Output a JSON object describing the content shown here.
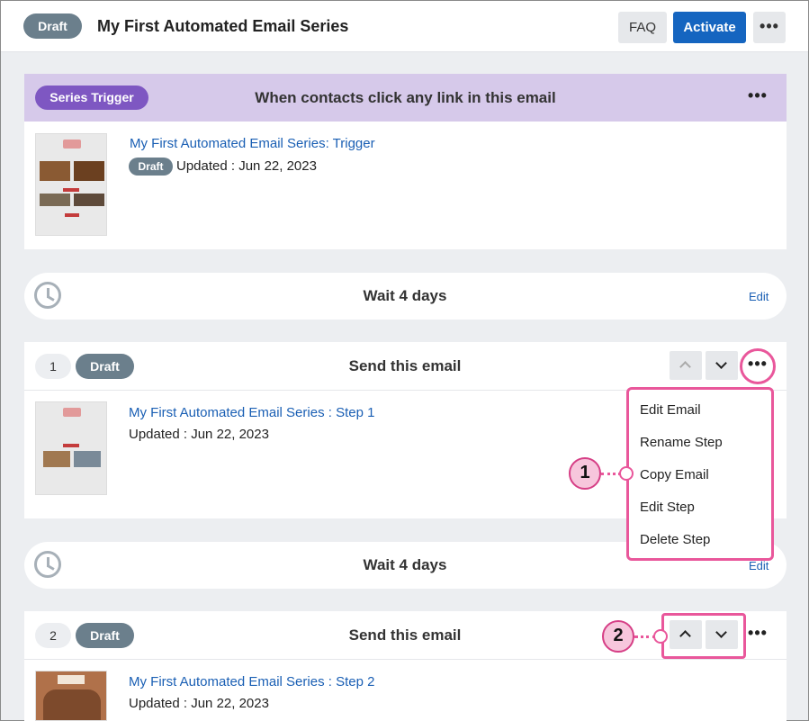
{
  "header": {
    "status_badge": "Draft",
    "title": "My First Automated Email Series",
    "faq_label": "FAQ",
    "activate_label": "Activate",
    "more_label": "•••"
  },
  "trigger": {
    "badge": "Series Trigger",
    "heading": "When contacts click any link in this email",
    "more_label": "•••",
    "email_title": "My First Automated Email Series: Trigger",
    "status_badge": "Draft",
    "updated": "Updated : Jun 22, 2023"
  },
  "waits": [
    {
      "label": "Wait 4 days",
      "edit_label": "Edit"
    },
    {
      "label": "Wait 4 days",
      "edit_label": "Edit"
    }
  ],
  "steps": [
    {
      "number": "1",
      "status_badge": "Draft",
      "heading": "Send this email",
      "more_label": "•••",
      "email_title": "My First Automated Email Series : Step 1",
      "updated": "Updated : Jun 22, 2023"
    },
    {
      "number": "2",
      "status_badge": "Draft",
      "heading": "Send this email",
      "more_label": "•••",
      "email_title": "My First Automated Email Series : Step 2",
      "updated": "Updated : Jun 22, 2023"
    }
  ],
  "step_menu": {
    "items": [
      "Edit Email",
      "Rename Step",
      "Copy Email",
      "Edit Step",
      "Delete Step"
    ]
  },
  "callouts": [
    "1",
    "2"
  ],
  "colors": {
    "accent_blue": "#1565c0",
    "trigger_band": "#d6c9ea",
    "trigger_badge": "#7e57c2",
    "draft_badge": "#6b7f8c",
    "highlight": "#e9579b"
  },
  "icons": [
    "clock-icon",
    "chevron-up-icon",
    "chevron-down-icon",
    "more-icon"
  ]
}
